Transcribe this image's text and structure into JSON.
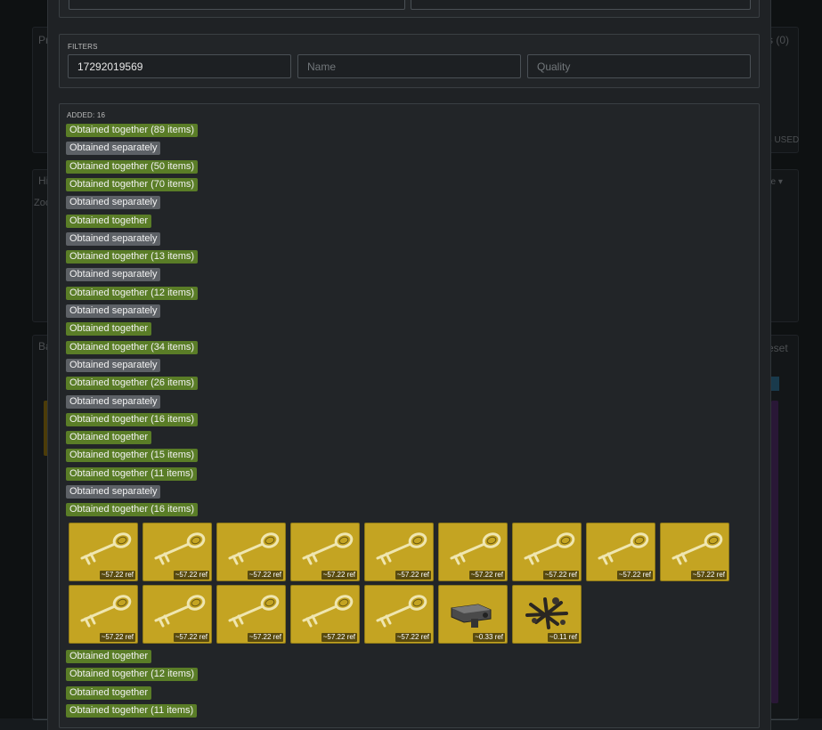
{
  "background": {
    "left_titles": [
      "Pr",
      "Hi",
      "Zoo",
      "Ba"
    ],
    "right_texts": [
      "s (0)",
      "S USED",
      "ge ▾",
      "eset",
      "et"
    ]
  },
  "filters": {
    "label": "FILTERS",
    "id_value": "17292019569",
    "name_placeholder": "Name",
    "quality_placeholder": "Quality"
  },
  "results": {
    "added_label": "ADDED: 16",
    "groups_before": [
      {
        "label": "Obtained together (89 items)",
        "kind": "together"
      },
      {
        "label": "Obtained separately",
        "kind": "separately"
      },
      {
        "label": "Obtained together (50 items)",
        "kind": "together"
      },
      {
        "label": "Obtained together (70 items)",
        "kind": "together"
      },
      {
        "label": "Obtained separately",
        "kind": "separately"
      },
      {
        "label": "Obtained together",
        "kind": "together"
      },
      {
        "label": "Obtained separately",
        "kind": "separately"
      },
      {
        "label": "Obtained together (13 items)",
        "kind": "together"
      },
      {
        "label": "Obtained separately",
        "kind": "separately"
      },
      {
        "label": "Obtained together (12 items)",
        "kind": "together"
      },
      {
        "label": "Obtained separately",
        "kind": "separately"
      },
      {
        "label": "Obtained together",
        "kind": "together"
      },
      {
        "label": "Obtained together (34 items)",
        "kind": "together"
      },
      {
        "label": "Obtained separately",
        "kind": "separately"
      },
      {
        "label": "Obtained together (26 items)",
        "kind": "together"
      },
      {
        "label": "Obtained separately",
        "kind": "separately"
      },
      {
        "label": "Obtained together (16 items)",
        "kind": "together"
      },
      {
        "label": "Obtained together",
        "kind": "together"
      },
      {
        "label": "Obtained together (15 items)",
        "kind": "together"
      },
      {
        "label": "Obtained together (11 items)",
        "kind": "together"
      },
      {
        "label": "Obtained separately",
        "kind": "separately"
      },
      {
        "label": "Obtained together (16 items)",
        "kind": "together"
      }
    ],
    "items": [
      {
        "icon": "key-icon",
        "price": "~57.22 ref"
      },
      {
        "icon": "key-icon",
        "price": "~57.22 ref"
      },
      {
        "icon": "key-icon",
        "price": "~57.22 ref"
      },
      {
        "icon": "key-icon",
        "price": "~57.22 ref"
      },
      {
        "icon": "key-icon",
        "price": "~57.22 ref"
      },
      {
        "icon": "key-icon",
        "price": "~57.22 ref"
      },
      {
        "icon": "key-icon",
        "price": "~57.22 ref"
      },
      {
        "icon": "key-icon",
        "price": "~57.22 ref"
      },
      {
        "icon": "key-icon",
        "price": "~57.22 ref"
      },
      {
        "icon": "key-icon",
        "price": "~57.22 ref"
      },
      {
        "icon": "key-icon",
        "price": "~57.22 ref"
      },
      {
        "icon": "key-icon",
        "price": "~57.22 ref"
      },
      {
        "icon": "key-icon",
        "price": "~57.22 ref"
      },
      {
        "icon": "key-icon",
        "price": "~57.22 ref"
      },
      {
        "icon": "metal-block-icon",
        "price": "~0.33 ref"
      },
      {
        "icon": "scrap-metal-icon",
        "price": "~0.11 ref"
      }
    ],
    "groups_after": [
      {
        "label": "Obtained together",
        "kind": "together"
      },
      {
        "label": "Obtained together (12 items)",
        "kind": "together"
      },
      {
        "label": "Obtained together",
        "kind": "together"
      },
      {
        "label": "Obtained together (11 items)",
        "kind": "together"
      }
    ]
  },
  "colors": {
    "together": "#5a7d27",
    "separately": "#5d6166",
    "unique_item": "#c4a422"
  }
}
